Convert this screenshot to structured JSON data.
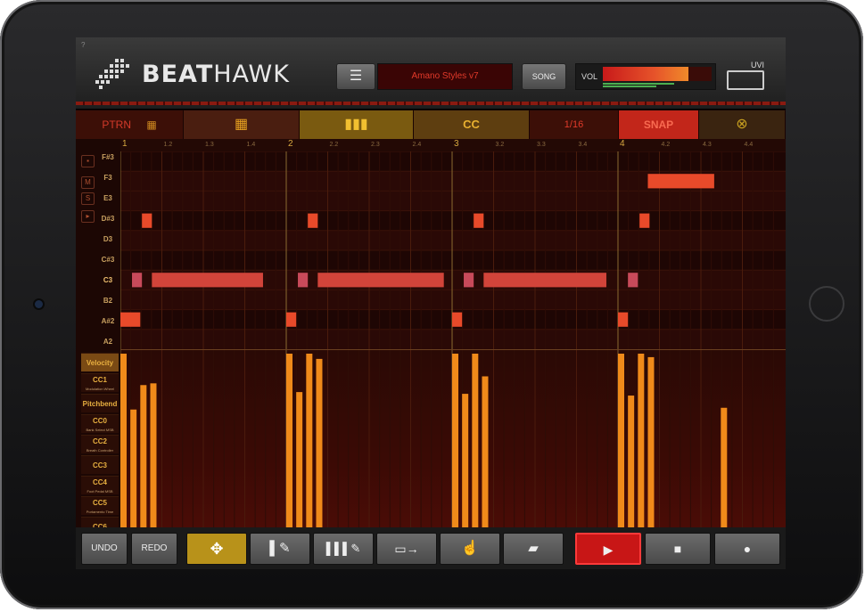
{
  "header": {
    "help": "?",
    "logo_bold": "BEAT",
    "logo_rest": "HAWK",
    "menu_icon": "hamburger-icon",
    "preset": "Amano Styles v7",
    "song": "SONG",
    "vol_label": "VOL",
    "vol_level": 0.8,
    "brand": "UVI"
  },
  "toolbar": {
    "ptrn": "PTRN",
    "grid_icon": "▦",
    "grid2_icon": "▦",
    "keys_icon": "▮▮▮",
    "cc": "CC",
    "resolution": "1/16",
    "snap": "SNAP",
    "close_icon": "⊗"
  },
  "ruler": {
    "bars": [
      "1",
      "2",
      "3",
      "4"
    ],
    "beats": [
      "1.2",
      "1.3",
      "1.4",
      "2.2",
      "2.3",
      "2.4",
      "3.2",
      "3.3",
      "3.4",
      "4.2",
      "4.3",
      "4.4"
    ]
  },
  "side": {
    "mini_buttons": [
      "M",
      "S",
      "▸"
    ],
    "notes": [
      "F#3",
      "F3",
      "E3",
      "D#3",
      "D3",
      "C#3",
      "C3",
      "B2",
      "A#2",
      "A2"
    ],
    "controllers": [
      {
        "name": "Velocity",
        "sub": ""
      },
      {
        "name": "CC1",
        "sub": "Modulation Wheel"
      },
      {
        "name": "Pitchbend",
        "sub": ""
      },
      {
        "name": "CC0",
        "sub": "Bank Select MSB"
      },
      {
        "name": "CC2",
        "sub": "Breath Controller"
      },
      {
        "name": "CC3",
        "sub": ""
      },
      {
        "name": "CC4",
        "sub": "Foot Pedal MSB"
      },
      {
        "name": "CC5",
        "sub": "Portamento Time"
      },
      {
        "name": "CC6",
        "sub": ""
      }
    ]
  },
  "bottom": {
    "undo": "UNDO",
    "redo": "REDO",
    "icons": [
      "move-icon",
      "draw-note-icon",
      "draw-multi-icon",
      "split-icon",
      "select-hand-icon",
      "eraser-icon",
      "play-icon",
      "stop-icon",
      "record-icon"
    ],
    "move_glyph": "✥",
    "draw_glyph": "▌✎",
    "multi_glyph": "▌▌▌✎",
    "split_glyph": "▭→",
    "hand_glyph": "☝",
    "eraser_glyph": "▰",
    "play_glyph": "▶",
    "stop_glyph": "■",
    "record_glyph": "●"
  },
  "colors": {
    "accent": "#e84a2a",
    "velocity_bar": "#f08a1a",
    "snap": "#c2261a",
    "play": "#c81616"
  },
  "notes_data": [
    {
      "pitch": "F3",
      "start": 4.18,
      "len": 0.4
    },
    {
      "pitch": "D#3",
      "start": 1.13,
      "len": 0.06
    },
    {
      "pitch": "D#3",
      "start": 2.13,
      "len": 0.06
    },
    {
      "pitch": "D#3",
      "start": 3.13,
      "len": 0.06
    },
    {
      "pitch": "D#3",
      "start": 4.13,
      "len": 0.06
    },
    {
      "pitch": "C3",
      "start": 1.07,
      "len": 0.06
    },
    {
      "pitch": "C3",
      "start": 1.19,
      "len": 0.67
    },
    {
      "pitch": "C3",
      "start": 2.07,
      "len": 0.06
    },
    {
      "pitch": "C3",
      "start": 2.19,
      "len": 0.76
    },
    {
      "pitch": "C3",
      "start": 3.07,
      "len": 0.06
    },
    {
      "pitch": "C3",
      "start": 3.19,
      "len": 0.74
    },
    {
      "pitch": "C3",
      "start": 4.06,
      "len": 0.06
    },
    {
      "pitch": "A#2",
      "start": 1.0,
      "len": 0.12
    },
    {
      "pitch": "A#2",
      "start": 2.0,
      "len": 0.06
    },
    {
      "pitch": "A#2",
      "start": 3.0,
      "len": 0.06
    },
    {
      "pitch": "A#2",
      "start": 4.0,
      "len": 0.06
    }
  ],
  "velocity_data": [
    {
      "pos": 1.0,
      "value": 1.0
    },
    {
      "pos": 1.06,
      "value": 0.68
    },
    {
      "pos": 1.12,
      "value": 0.82
    },
    {
      "pos": 1.18,
      "value": 0.83
    },
    {
      "pos": 2.0,
      "value": 1.0
    },
    {
      "pos": 2.06,
      "value": 0.78
    },
    {
      "pos": 2.12,
      "value": 1.0
    },
    {
      "pos": 2.18,
      "value": 0.97
    },
    {
      "pos": 3.0,
      "value": 1.0
    },
    {
      "pos": 3.06,
      "value": 0.77
    },
    {
      "pos": 3.12,
      "value": 1.0
    },
    {
      "pos": 3.18,
      "value": 0.87
    },
    {
      "pos": 4.0,
      "value": 1.0
    },
    {
      "pos": 4.06,
      "value": 0.76
    },
    {
      "pos": 4.12,
      "value": 1.0
    },
    {
      "pos": 4.18,
      "value": 0.98
    },
    {
      "pos": 4.62,
      "value": 0.69
    }
  ]
}
